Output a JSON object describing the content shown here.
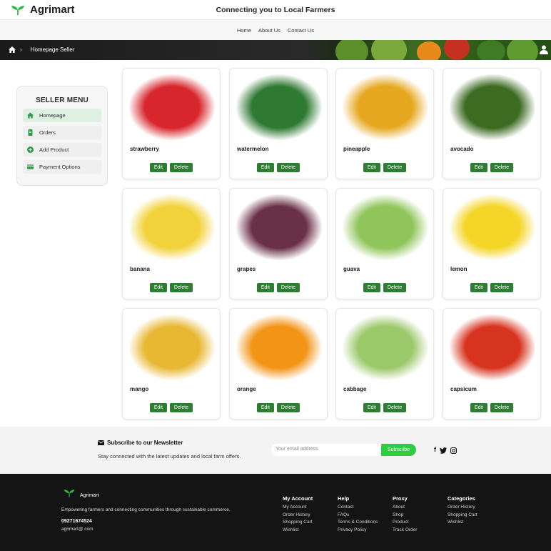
{
  "header": {
    "brand": "Agrimart",
    "tagline": "Connecting you to Local Farmers"
  },
  "nav": {
    "items": [
      "Home",
      "About Us",
      "Contact Us"
    ]
  },
  "breadcrumb": {
    "separator": "›",
    "current": "Homepage Seller"
  },
  "seller_menu": {
    "title": "SELLER MENU",
    "items": [
      {
        "label": "Homepage",
        "icon": "home-icon"
      },
      {
        "label": "Orders",
        "icon": "orders-icon"
      },
      {
        "label": "Add Product",
        "icon": "add-icon"
      },
      {
        "label": "Payment Options",
        "icon": "card-icon"
      }
    ]
  },
  "product_actions": {
    "edit": "Edit",
    "delete": "Delete"
  },
  "products": [
    {
      "name": "strawberry",
      "color": "#d7262c"
    },
    {
      "name": "watermelon",
      "color": "#2f7a33"
    },
    {
      "name": "pineapple",
      "color": "#e6a820"
    },
    {
      "name": "avocado",
      "color": "#3c6b22"
    },
    {
      "name": "banana",
      "color": "#f2d23a"
    },
    {
      "name": "grapes",
      "color": "#6a3046"
    },
    {
      "name": "guava",
      "color": "#8fc55a"
    },
    {
      "name": "lemon",
      "color": "#f4d628"
    },
    {
      "name": "mango",
      "color": "#e8b833"
    },
    {
      "name": "orange",
      "color": "#f29416"
    },
    {
      "name": "cabbage",
      "color": "#9bc869"
    },
    {
      "name": "capsicum",
      "color": "#d7341f"
    }
  ],
  "newsletter": {
    "title": "Subscribe to our Newsletter",
    "subtitle": "Stay connected with the latest updates and local farm offers.",
    "placeholder": "Your email address",
    "button": "Subscribe",
    "social": [
      "f",
      "🐦",
      "◎"
    ]
  },
  "footer": {
    "brand": "Agrimart",
    "description": "Empowering farmers and connecting communities through sustainable commerce.",
    "phone": "09271674524",
    "email": "agrimart@ com",
    "columns": [
      {
        "heading": "My Account",
        "links": [
          "My Account",
          "Order History",
          "Shopping Cart",
          "Wishlist"
        ]
      },
      {
        "heading": "Help",
        "links": [
          "Contact",
          "FAQs",
          "Terms & Conditions",
          "Privacy Policy"
        ]
      },
      {
        "heading": "Proxy",
        "links": [
          "About",
          "Shop",
          "Product",
          "Track Order"
        ]
      },
      {
        "heading": "Categories",
        "links": [
          "Order History",
          "Shopping Cart",
          "Wishlist"
        ]
      }
    ]
  },
  "colors": {
    "accent_green": "#2e7d32",
    "subscribe_green": "#2ecc40",
    "footer_bg": "#141414"
  }
}
